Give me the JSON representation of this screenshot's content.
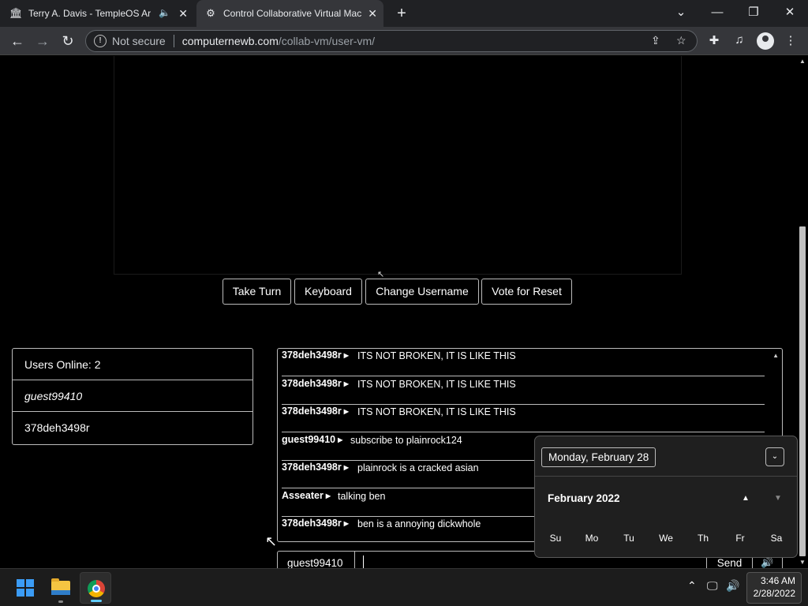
{
  "browser": {
    "tabs": [
      {
        "title": "Terry A. Davis - TempleOS Ar",
        "icon": "temple-icon",
        "muted": true
      },
      {
        "title": "Control Collaborative Virtual Mac",
        "icon": "collabvm-icon",
        "active": true
      }
    ],
    "address": {
      "security_label": "Not secure",
      "host": "computernewb.com",
      "path": "/collab-vm/user-vm/"
    }
  },
  "vm_controls": {
    "take_turn": "Take Turn",
    "keyboard": "Keyboard",
    "change_username": "Change Username",
    "vote_reset": "Vote for Reset"
  },
  "users_panel": {
    "header": "Users Online: 2",
    "users": [
      "guest99410",
      "378deh3498r"
    ]
  },
  "chat": {
    "messages": [
      {
        "user": "378deh3498r",
        "text": "ITS NOT BROKEN, IT IS LIKE THIS"
      },
      {
        "user": "378deh3498r",
        "text": "ITS NOT BROKEN, IT IS LIKE THIS"
      },
      {
        "user": "378deh3498r",
        "text": "ITS NOT BROKEN, IT IS LIKE THIS"
      },
      {
        "user": "guest99410",
        "text": "subscribe to plainrock124"
      },
      {
        "user": "378deh3498r",
        "text": "plainrock is a cracked asian"
      },
      {
        "user": "Asseater",
        "text": "talking ben"
      },
      {
        "user": "378deh3498r",
        "text": "ben is a annoying dickwhole"
      }
    ],
    "username": "guest99410",
    "input_value": "",
    "send_label": "Send"
  },
  "calendar": {
    "selected_date": "Monday, February 28",
    "month_label": "February 2022",
    "weekdays": [
      "Su",
      "Mo",
      "Tu",
      "We",
      "Th",
      "Fr",
      "Sa"
    ]
  },
  "taskbar": {
    "time": "3:46 AM",
    "date": "2/28/2022"
  }
}
